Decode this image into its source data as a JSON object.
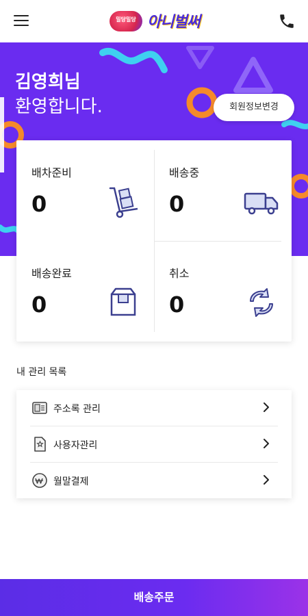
{
  "header": {
    "logo_badge": "밀당밀당",
    "logo_text": "아니벌써",
    "menu_icon": "hamburger-menu-icon",
    "phone_icon": "phone-icon"
  },
  "hero": {
    "greeting_name": "김영희님",
    "greeting_line2": "환영합니다.",
    "profile_button": "회원정보변경",
    "background_color": "#6a2cf0"
  },
  "status": {
    "items": [
      {
        "label": "배차준비",
        "count": "0",
        "icon": "hand-truck-boxes-icon"
      },
      {
        "label": "배송중",
        "count": "0",
        "icon": "delivery-truck-icon"
      },
      {
        "label": "배송완료",
        "count": "0",
        "icon": "package-box-icon"
      },
      {
        "label": "취소",
        "count": "0",
        "icon": "refresh-arrows-icon"
      }
    ]
  },
  "management": {
    "title": "내 관리 목록",
    "items": [
      {
        "label": "주소록 관리",
        "icon": "address-book-icon"
      },
      {
        "label": "사용자관리",
        "icon": "user-document-icon"
      },
      {
        "label": "월말결제",
        "icon": "won-coin-icon"
      }
    ]
  },
  "cta": {
    "label": "배송주문",
    "gradient_start": "#5b2de6",
    "gradient_end": "#9b32e8"
  }
}
